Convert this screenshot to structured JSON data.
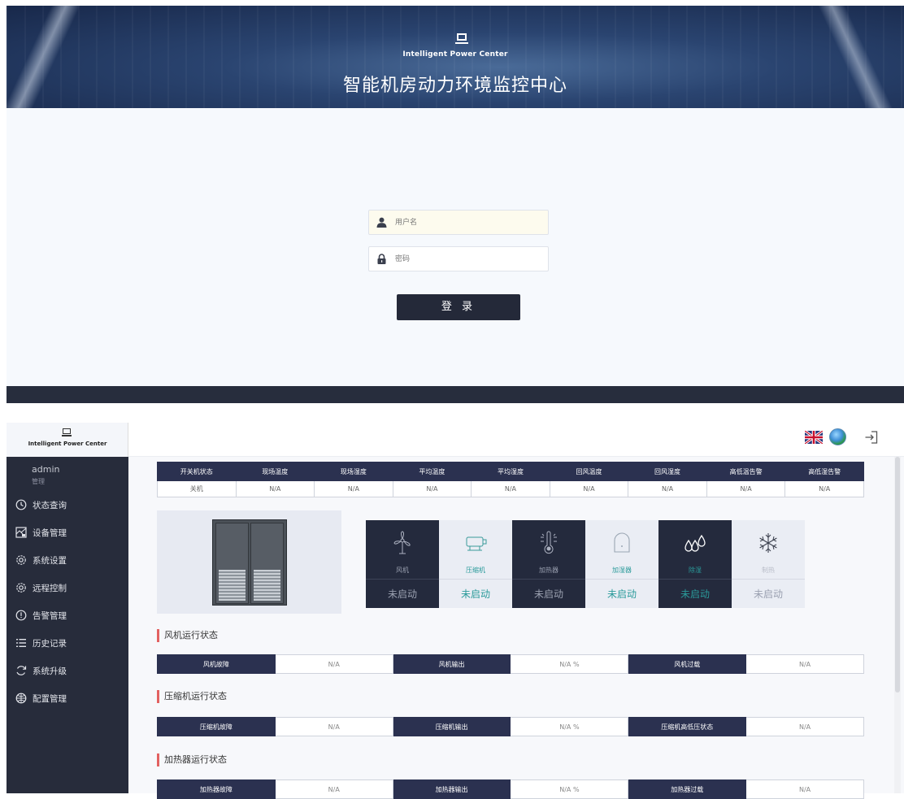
{
  "login": {
    "brand_en": "Intelligent Power Center",
    "title": "智能机房动力环境监控中心",
    "username_placeholder": "用户名",
    "password_placeholder": "密码",
    "login_button": "登 录"
  },
  "dashboard": {
    "brand_en": "Intelligent Power Center",
    "user": {
      "name": "admin",
      "role": "管理"
    },
    "menu": [
      {
        "label": "状态查询",
        "icon": "clock-icon"
      },
      {
        "label": "设备管理",
        "icon": "device-icon"
      },
      {
        "label": "系统设置",
        "icon": "gear-icon"
      },
      {
        "label": "远程控制",
        "icon": "gear-icon"
      },
      {
        "label": "告警管理",
        "icon": "alert-icon"
      },
      {
        "label": "历史记录",
        "icon": "list-icon"
      },
      {
        "label": "系统升级",
        "icon": "refresh-icon"
      },
      {
        "label": "配置管理",
        "icon": "config-icon"
      }
    ],
    "status_table": {
      "headers": [
        "开关机状态",
        "现场温度",
        "现场湿度",
        "平均温度",
        "平均湿度",
        "回风温度",
        "回风湿度",
        "高低温告警",
        "高低湿告警"
      ],
      "values": [
        "关机",
        "N/A",
        "N/A",
        "N/A",
        "N/A",
        "N/A",
        "N/A",
        "N/A",
        "N/A"
      ]
    },
    "components": [
      {
        "name": "风机",
        "state": "未启动",
        "theme": "dark",
        "icon": "fan-icon",
        "name_color": "#9aa0b0",
        "state_color": "#9aa0b0"
      },
      {
        "name": "压缩机",
        "state": "未启动",
        "theme": "light",
        "icon": "compressor-icon",
        "name_color": "#2a9a9a",
        "state_color": "#2a9a9a"
      },
      {
        "name": "加热器",
        "state": "未启动",
        "theme": "dark",
        "icon": "heater-icon",
        "name_color": "#9aa0b0",
        "state_color": "#9aa0b0"
      },
      {
        "name": "加湿器",
        "state": "未启动",
        "theme": "light",
        "icon": "humidifier-icon",
        "name_color": "#2a9a9a",
        "state_color": "#2a9a9a"
      },
      {
        "name": "除湿",
        "state": "未启动",
        "theme": "dark",
        "icon": "dehumidify-icon",
        "name_color": "#2a9a9a",
        "state_color": "#2a9a9a"
      },
      {
        "name": "制热",
        "state": "未启动",
        "theme": "light",
        "icon": "snowflake-icon",
        "name_color": "#b9bdc8",
        "state_color": "#9aa0b0"
      }
    ],
    "sections": [
      {
        "title": "风机运行状态",
        "cells": [
          "风机故障",
          "N/A",
          "风机输出",
          "N/A %",
          "风机过载",
          "N/A"
        ]
      },
      {
        "title": "压缩机运行状态",
        "cells": [
          "压缩机故障",
          "N/A",
          "压缩机输出",
          "N/A %",
          "压缩机高低压状态",
          "N/A"
        ]
      },
      {
        "title": "加热器运行状态",
        "cells": [
          "加热器故障",
          "N/A",
          "加热器输出",
          "N/A %",
          "加热器过载",
          "N/A"
        ]
      }
    ]
  }
}
